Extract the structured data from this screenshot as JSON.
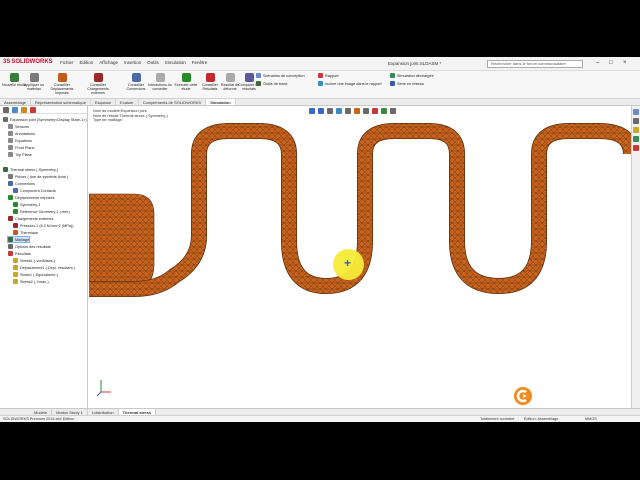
{
  "app": {
    "name": "SOLIDWORKS",
    "doc_title": "Expansion joint.SLDASM *",
    "search_placeholder": "Rechercher dans le forum communautaire",
    "menu": [
      "Fichier",
      "Edition",
      "Affichage",
      "Insertion",
      "Outils",
      "Simulation",
      "Fenêtre"
    ]
  },
  "ribbon": {
    "big_buttons": [
      {
        "label": "Nouvelle étude",
        "color": "#3a7d3a"
      },
      {
        "label": "Appliquer un matériau",
        "color": "#7a7a7a"
      },
      {
        "label": "Conseiller Déplacements imposés",
        "color": "#c45a1a"
      },
      {
        "label": "Conseiller Chargements externes",
        "color": "#9a2a2a"
      },
      {
        "label": "Conseiller Connexions",
        "color": "#4a6aa8"
      },
      {
        "label": "Interactions du conseiller",
        "color": "#aaaaaa"
      },
      {
        "label": "Exécuter cette étude",
        "color": "#2a8a2a"
      },
      {
        "label": "Conseiller Résultats",
        "color": "#c42a2a"
      },
      {
        "label": "Résultat de déformé",
        "color": "#aaaaaa"
      },
      {
        "label": "Comparer les résultats",
        "color": "#5a5a9a"
      }
    ],
    "small_buttons": [
      {
        "label": "Scénarios de conception",
        "color": "#6a8ac8"
      },
      {
        "label": "Outils de tracé",
        "color": "#3a6a3a"
      },
      {
        "label": "Rapport",
        "color": "#c83a3a"
      },
      {
        "label": "Inclure une image dans le rapport",
        "color": "#3a8ac8"
      },
      {
        "label": "Simulation déchargée",
        "color": "#3a8a5a"
      },
      {
        "label": "Série en réseau",
        "color": "#3a5aa8"
      }
    ]
  },
  "tabs": [
    "Assemblage",
    "Représentation schématique",
    "Esquisse",
    "Evaluer",
    "Compléments de SOLIDWORKS",
    "Simulation"
  ],
  "active_tab": "Simulation",
  "tree": {
    "top_item": "Expansion joint (Symmetry<Display State-1>)",
    "items_top": [
      "Sensors",
      "Annotations",
      "Equations",
      "Front Plane",
      "Top Plane"
    ],
    "study": "Thermal stress (-Symmetry-)",
    "items": [
      {
        "label": "Pièces ( due de symétrie Axial )",
        "indent": 1,
        "color": "#7a7a7a"
      },
      {
        "label": "Connexions",
        "indent": 1,
        "color": "#4a6aa8"
      },
      {
        "label": "Component Contacts",
        "indent": 2,
        "color": "#4a6aa8"
      },
      {
        "label": "Déplacements imposés",
        "indent": 1,
        "color": "#2a8a2a"
      },
      {
        "label": "Symmetry-1",
        "indent": 2,
        "color": "#2a8a2a"
      },
      {
        "label": "Reference Geometry-1 (:mm)",
        "indent": 2,
        "color": "#2a8a2a"
      },
      {
        "label": "Chargements externes",
        "indent": 1,
        "color": "#9a2a2a"
      },
      {
        "label": "Pression-1 (8.3 N/mm^2 (MPa))",
        "indent": 2,
        "color": "#9a2a2a"
      },
      {
        "label": "Thermique",
        "indent": 2,
        "color": "#c85a1a"
      },
      {
        "label": "Maillage",
        "indent": 1,
        "color": "#3a6a3a",
        "selected": true
      },
      {
        "label": "Options des résultats",
        "indent": 1,
        "color": "#6a6a6a"
      },
      {
        "label": "Résultats",
        "indent": 1,
        "color": "#c83a3a"
      },
      {
        "label": "Stress1 (-vonMises-)",
        "indent": 2,
        "color": "#c8a82a"
      },
      {
        "label": "Déplacement1 (-Dépl. résultant-)",
        "indent": 2,
        "color": "#c8a82a"
      },
      {
        "label": "Strain1 (-Equivalente-)",
        "indent": 2,
        "color": "#c8a82a"
      },
      {
        "label": "Stress2 (-Ymax-)",
        "indent": 2,
        "color": "#c8a82a"
      }
    ]
  },
  "viewport": {
    "info_lines": [
      "Nom du modèle:Expansion joint",
      "Nom de l'étude:Thermal stress (-Symmetry-)",
      "Type de maillage:"
    ],
    "mesh_color": "#c8641e"
  },
  "bottom_tabs": [
    "Modèle",
    "Motion Study 1",
    "t-distribution",
    "Thermal stress"
  ],
  "active_bottom_tab": "Thermal stress",
  "status": {
    "left": "SOLIDWORKS Premium 2018 x64 Edition",
    "mid1": "Totalement contraint",
    "mid2": "Édition: Assemblage",
    "right": "MMGS"
  }
}
